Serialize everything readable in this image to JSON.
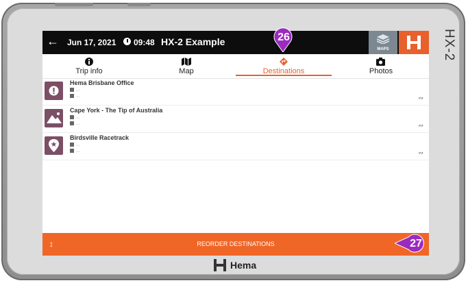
{
  "device": {
    "model": "HX-2",
    "brand": "Hema"
  },
  "header": {
    "back_icon": "arrow-left-icon",
    "date": "Jun 17, 2021",
    "time": "09:48",
    "trip_name": "HX-2 Example",
    "maps_label": "MAPS"
  },
  "tabs": [
    {
      "label": "Trip info",
      "icon": "info-icon"
    },
    {
      "label": "Map",
      "icon": "map-icon"
    },
    {
      "label": "Destinations",
      "icon": "direction-icon",
      "active": true
    },
    {
      "label": "Photos",
      "icon": "camera-icon"
    }
  ],
  "destinations": [
    {
      "title": "Hema Brisbane Office",
      "detail_1": "...",
      "detail_2": "...",
      "icon": "alert-icon"
    },
    {
      "title": "Cape York - The Tip of Australia",
      "detail_1": "...",
      "detail_2": "...",
      "icon": "mountain-icon"
    },
    {
      "title": "Birdsville Racetrack",
      "detail_1": "...",
      "detail_2": "...",
      "icon": "star-pin-icon"
    }
  ],
  "reorder": {
    "label": "REORDER DESTINATIONS"
  },
  "annotations": {
    "badge_1": "26",
    "badge_2": "27"
  },
  "colors": {
    "accent": "#e8602c",
    "header_bg": "#0d0d0d",
    "badge": "#9b2bbf",
    "thumb": "#7b4f66"
  }
}
